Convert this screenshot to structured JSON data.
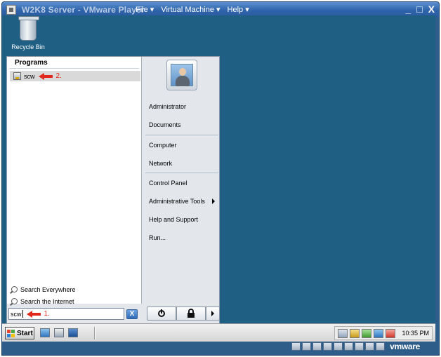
{
  "vm": {
    "title": "W2K8 Server - VMware Player",
    "menu": [
      {
        "label": "File"
      },
      {
        "label": "Virtual Machine"
      },
      {
        "label": "Help"
      }
    ],
    "controls": {
      "minimize": "_",
      "maximize": "□",
      "close": "X"
    },
    "brand": "vmware"
  },
  "desktop": {
    "recycle_bin_label": "Recycle Bin",
    "background_color": "#1f5f83"
  },
  "start_menu": {
    "programs_header": "Programs",
    "programs": [
      {
        "label": "scw",
        "icon": "scw-program-icon"
      }
    ],
    "annotations": {
      "step1": "1.",
      "step2": "2.",
      "arrow_color": "#e0281c"
    },
    "search_links": [
      {
        "label": "Search Everywhere"
      },
      {
        "label": "Search the Internet"
      }
    ],
    "search_box": {
      "value": "scw"
    },
    "clear_button": "X",
    "right_items": [
      {
        "label": "Administrator"
      },
      {
        "label": "Documents"
      },
      {
        "label": "Computer"
      },
      {
        "label": "Network"
      },
      {
        "label": "Control Panel"
      },
      {
        "label": "Administrative Tools",
        "has_submenu": true
      },
      {
        "label": "Help and Support"
      },
      {
        "label": "Run..."
      }
    ]
  },
  "taskbar": {
    "start_label": "Start",
    "quick_launch": [
      "ie-icon",
      "server-manager-icon",
      "show-desktop-icon"
    ],
    "tray_icons": [
      "network-icon",
      "security-icon",
      "update-icon",
      "display-icon",
      "volume-icon"
    ],
    "clock": "10:35 PM"
  },
  "statusbar": {
    "device_icons": [
      "hdd-icon",
      "cdrom-icon",
      "floppy-icon",
      "network-adapter-icon",
      "usb-icon",
      "printer-icon",
      "sound-icon",
      "message-icon",
      "vm-icon"
    ]
  }
}
